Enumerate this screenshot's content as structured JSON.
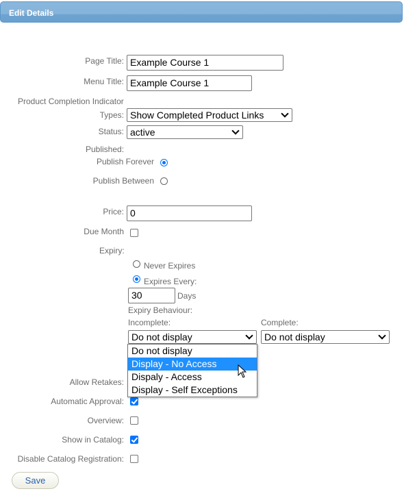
{
  "header": {
    "title": "Edit Details"
  },
  "form": {
    "page_title": {
      "label": "Page Title:",
      "value": "Example Course 1"
    },
    "menu_title": {
      "label": "Menu Title:",
      "value": "Example Course 1"
    },
    "completion_indicator": {
      "label_line1": "Product Completion Indicator",
      "label_line2": "Types:",
      "value": "Show Completed Product Links"
    },
    "status": {
      "label": "Status:",
      "value": "active"
    },
    "published": {
      "label": "Published:",
      "forever": {
        "label": "Publish Forever",
        "checked": true
      },
      "between": {
        "label": "Publish Between",
        "checked": false
      }
    },
    "price": {
      "label": "Price:",
      "value": "0"
    },
    "due_month": {
      "label": "Due Month",
      "checked": false
    },
    "expiry": {
      "label": "Expiry:",
      "never": {
        "label": "Never Expires",
        "checked": false
      },
      "every": {
        "label": "Expires Every:",
        "checked": true
      },
      "days_value": "30",
      "days_label": "Days",
      "behaviour_label": "Expiry Behaviour:",
      "incomplete_label": "Incomplete:",
      "incomplete_value": "Do not display",
      "complete_label": "Complete:",
      "complete_value": "Do not display",
      "incomplete_options": [
        "Do not display",
        "Display - No Access",
        "Dispaly - Access",
        "Display - Self Exceptions"
      ],
      "highlighted_option": "Display - No Access"
    },
    "allow_retakes": {
      "label": "Allow Retakes:"
    },
    "automatic_approval": {
      "label": "Automatic Approval:",
      "checked": true
    },
    "overview": {
      "label": "Overview:",
      "checked": false
    },
    "show_in_catalog": {
      "label": "Show in Catalog:",
      "checked": true
    },
    "disable_catalog_registration": {
      "label": "Disable Catalog Registration:",
      "checked": false
    }
  },
  "buttons": {
    "save": "Save"
  },
  "colors": {
    "accent": "#0075ff",
    "header": "#86b3da",
    "highlight": "#1e90ff"
  }
}
